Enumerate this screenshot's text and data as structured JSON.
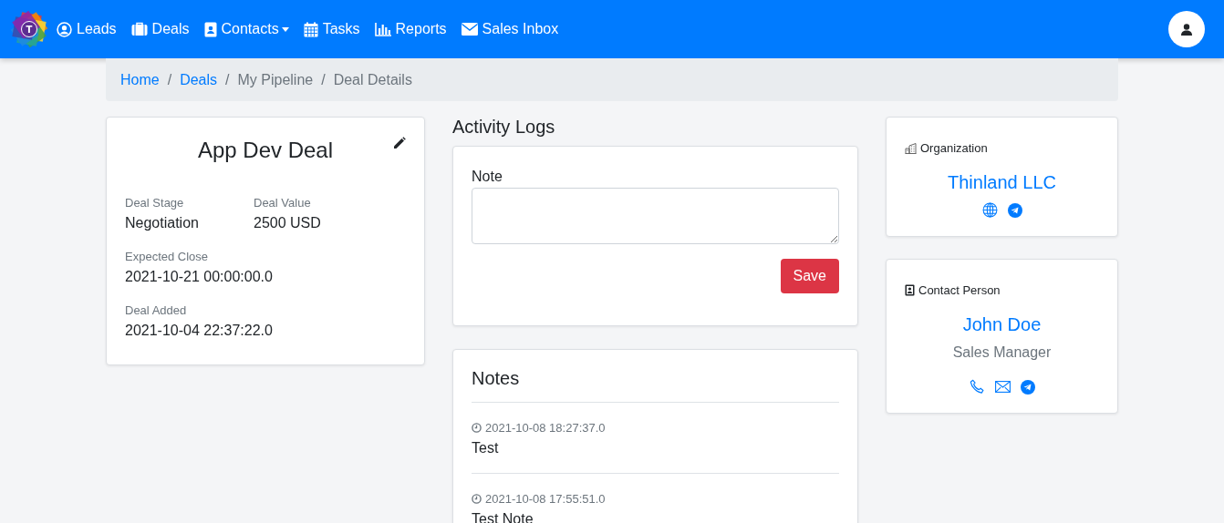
{
  "navbar": {
    "logo_letter": "T",
    "items": [
      {
        "label": "Leads",
        "dropdown": false
      },
      {
        "label": "Deals",
        "dropdown": false
      },
      {
        "label": "Contacts",
        "dropdown": true
      },
      {
        "label": "Tasks",
        "dropdown": false
      },
      {
        "label": "Reports",
        "dropdown": false
      },
      {
        "label": "Sales Inbox",
        "dropdown": false
      }
    ]
  },
  "breadcrumb": [
    {
      "label": "Home",
      "link": true
    },
    {
      "separator": "/",
      "label": "Deals",
      "link": true
    },
    {
      "separator": "/",
      "label": "My Pipeline",
      "link": false
    },
    {
      "separator": "/",
      "label": "Deal Details",
      "link": false
    }
  ],
  "deal": {
    "title": "App Dev Deal",
    "rows": [
      [
        {
          "label": "Deal Stage",
          "value": "Negotiation"
        },
        {
          "label": "Deal Value",
          "value": "2500 USD"
        }
      ],
      [
        {
          "label": "Expected Close",
          "value": "2021-10-21 00:00:00.0"
        }
      ],
      [
        {
          "label": "Deal Added",
          "value": "2021-10-04 22:37:22.0"
        }
      ]
    ]
  },
  "activity_logs": {
    "heading": "Activity Logs",
    "field_label": "Note",
    "button": "Save"
  },
  "notes": {
    "heading": "Notes",
    "entries": [
      {
        "time": "2021-10-08 18:27:37.0",
        "text": "Test"
      },
      {
        "time": "2021-10-08 17:55:51.0",
        "text": "Test Note"
      }
    ]
  },
  "organization": {
    "label": "Organization",
    "name": "Thinland LLC",
    "links": [
      {
        "kind": "web"
      },
      {
        "kind": "telegram"
      }
    ]
  },
  "contact": {
    "label": "Contact Person",
    "name": "John Doe",
    "title": "Sales Manager",
    "links": [
      {
        "kind": "phone"
      },
      {
        "kind": "email"
      },
      {
        "kind": "telegram"
      }
    ]
  }
}
